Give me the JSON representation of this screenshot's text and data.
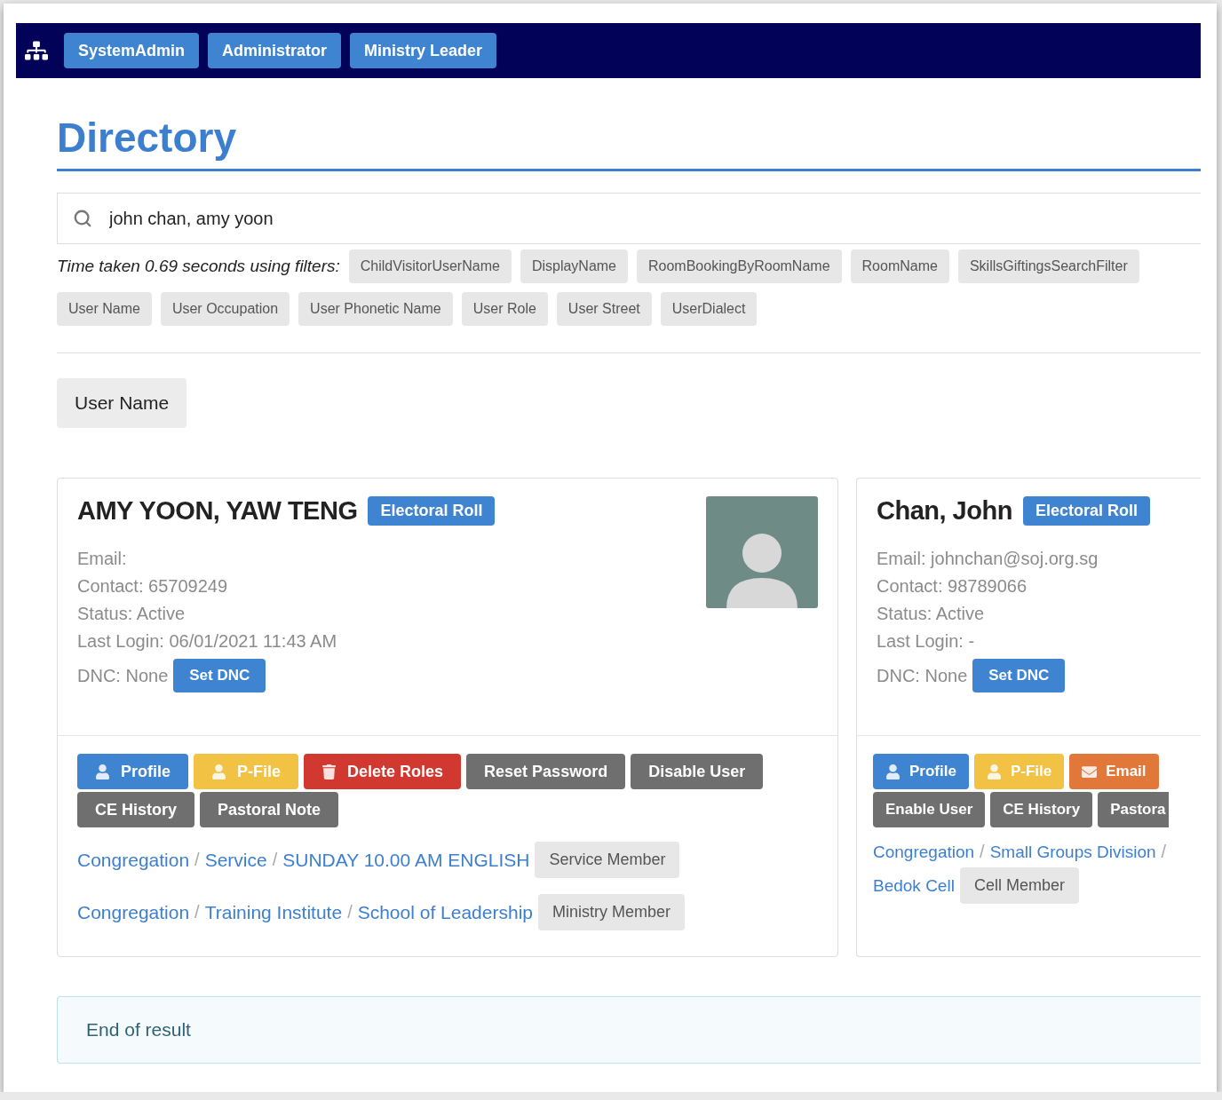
{
  "navbar": {
    "roles": [
      "SystemAdmin",
      "Administrator",
      "Ministry Leader"
    ]
  },
  "page_title": "Directory",
  "search": {
    "value": "john chan, amy yoon"
  },
  "filters": {
    "summary": "Time taken 0.69 seconds using filters:",
    "chips": [
      "ChildVisitorUserName",
      "DisplayName",
      "RoomBookingByRoomName",
      "RoomName",
      "SkillsGiftingsSearchFilter",
      "User Name",
      "User Occupation",
      "User Phonetic Name",
      "User Role",
      "User Street",
      "UserDialect"
    ]
  },
  "sort_button": "User Name",
  "cards": [
    {
      "name": "AMY YOON, YAW TENG",
      "badge": "Electoral Roll",
      "details": [
        "Email:",
        "Contact: 65709249",
        "Status: Active",
        "Last Login: 06/01/2021 11:43 AM"
      ],
      "dnc": "DNC: None",
      "dnc_button": "Set DNC",
      "actions": [
        {
          "label": "Profile",
          "kind": "profile"
        },
        {
          "label": "P-File",
          "kind": "pfile"
        },
        {
          "label": "Delete Roles",
          "kind": "delete"
        },
        {
          "label": "Reset Password",
          "kind": "plain"
        },
        {
          "label": "Disable User",
          "kind": "plain"
        },
        {
          "label": "CE History",
          "kind": "plain"
        },
        {
          "label": "Pastoral Note",
          "kind": "plain"
        }
      ],
      "memberships": [
        {
          "path": [
            "Congregation",
            "Service",
            "SUNDAY 10.00 AM ENGLISH"
          ],
          "separator": "/",
          "role": "Service Member"
        },
        {
          "path": [
            "Congregation",
            "Training Institute",
            "School of Leadership"
          ],
          "separator": "/",
          "role": "Ministry Member"
        }
      ]
    },
    {
      "name": "Chan, John",
      "badge": "Electoral Roll",
      "details": [
        "Email: johnchan@soj.org.sg",
        "Contact: 98789066",
        "Status: Active",
        "Last Login: -"
      ],
      "dnc": "DNC: None",
      "dnc_button": "Set DNC",
      "actions": [
        {
          "label": "Profile",
          "kind": "profile"
        },
        {
          "label": "P-File",
          "kind": "pfile"
        },
        {
          "label": "Email",
          "kind": "email"
        },
        {
          "label": "Enable User",
          "kind": "plain"
        },
        {
          "label": "CE History",
          "kind": "plain"
        },
        {
          "label": "Pastora",
          "kind": "plain"
        }
      ],
      "memberships": [
        {
          "path": [
            "Congregation",
            "Small Groups Division",
            "Bedok Cell"
          ],
          "separator": "/",
          "role": "Cell Member"
        }
      ]
    }
  ],
  "result_note": "End of result"
}
